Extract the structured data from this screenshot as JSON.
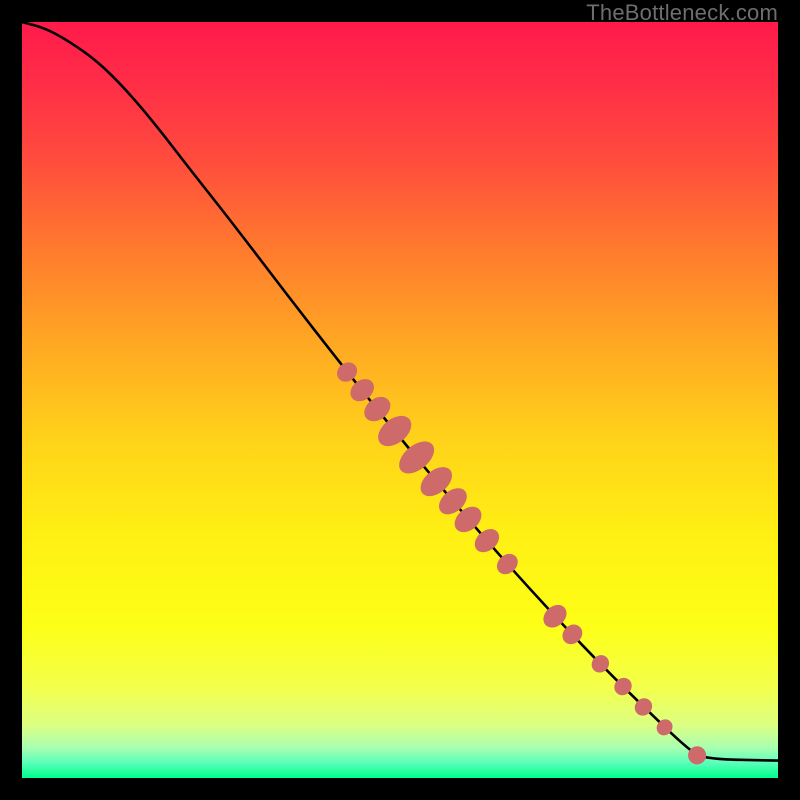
{
  "watermark": "TheBottleneck.com",
  "colors": {
    "gradient_stops": [
      {
        "offset": 0.0,
        "color": "#ff1a4b"
      },
      {
        "offset": 0.08,
        "color": "#ff2d47"
      },
      {
        "offset": 0.18,
        "color": "#ff4b3d"
      },
      {
        "offset": 0.3,
        "color": "#ff7a2e"
      },
      {
        "offset": 0.42,
        "color": "#ffa623"
      },
      {
        "offset": 0.55,
        "color": "#ffd21a"
      },
      {
        "offset": 0.68,
        "color": "#fff013"
      },
      {
        "offset": 0.8,
        "color": "#fdff17"
      },
      {
        "offset": 0.88,
        "color": "#f3ff4b"
      },
      {
        "offset": 0.93,
        "color": "#dcff83"
      },
      {
        "offset": 0.96,
        "color": "#a8ffb1"
      },
      {
        "offset": 0.98,
        "color": "#5affb9"
      },
      {
        "offset": 1.0,
        "color": "#00ff8c"
      }
    ],
    "curve": "#000000",
    "dot": "#ce6a69",
    "frame": "#000000"
  },
  "chart_data": {
    "type": "line",
    "title": "",
    "xlabel": "",
    "ylabel": "",
    "xlim": [
      0,
      100
    ],
    "ylim": [
      0,
      100
    ],
    "curve": {
      "x": [
        0,
        3,
        6,
        10,
        14,
        18,
        22,
        28,
        35,
        42,
        50,
        56,
        62,
        67,
        72,
        76,
        80,
        83.5,
        86,
        88,
        90,
        100
      ],
      "y": [
        100,
        99.2,
        97.6,
        94.8,
        90.8,
        86.0,
        80.8,
        73.2,
        64.0,
        55.0,
        45.0,
        37.8,
        30.8,
        25.2,
        19.8,
        15.6,
        11.6,
        8.2,
        5.8,
        4.0,
        2.5,
        2.3
      ]
    },
    "dot_clusters": [
      {
        "center_x": 43.0,
        "center_y": 53.7,
        "rx": 1.2,
        "ry": 1.4
      },
      {
        "center_x": 45.0,
        "center_y": 51.3,
        "rx": 1.3,
        "ry": 1.7
      },
      {
        "center_x": 47.0,
        "center_y": 48.8,
        "rx": 1.4,
        "ry": 1.9
      },
      {
        "center_x": 49.3,
        "center_y": 45.9,
        "rx": 1.6,
        "ry": 2.5
      },
      {
        "center_x": 52.2,
        "center_y": 42.4,
        "rx": 1.6,
        "ry": 2.7
      },
      {
        "center_x": 54.8,
        "center_y": 39.2,
        "rx": 1.5,
        "ry": 2.4
      },
      {
        "center_x": 57.0,
        "center_y": 36.6,
        "rx": 1.4,
        "ry": 2.1
      },
      {
        "center_x": 59.0,
        "center_y": 34.2,
        "rx": 1.4,
        "ry": 2.0
      },
      {
        "center_x": 61.5,
        "center_y": 31.4,
        "rx": 1.3,
        "ry": 1.8
      },
      {
        "center_x": 64.2,
        "center_y": 28.3,
        "rx": 1.2,
        "ry": 1.5
      },
      {
        "center_x": 70.5,
        "center_y": 21.4,
        "rx": 1.3,
        "ry": 1.7
      },
      {
        "center_x": 72.8,
        "center_y": 19.0,
        "rx": 1.2,
        "ry": 1.4
      },
      {
        "center_x": 76.5,
        "center_y": 15.1,
        "rx": 1.1,
        "ry": 1.2
      },
      {
        "center_x": 79.5,
        "center_y": 12.1,
        "rx": 1.1,
        "ry": 1.2
      },
      {
        "center_x": 82.2,
        "center_y": 9.4,
        "rx": 1.1,
        "ry": 1.2
      },
      {
        "center_x": 85.0,
        "center_y": 6.7,
        "rx": 1.0,
        "ry": 1.1
      },
      {
        "center_x": 89.3,
        "center_y": 3.0,
        "rx": 1.2,
        "ry": 1.2
      }
    ]
  }
}
